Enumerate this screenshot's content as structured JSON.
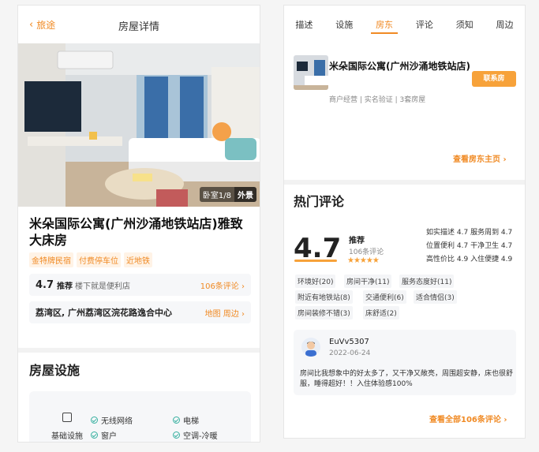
{
  "left": {
    "back_label": "旅途",
    "title": "房屋详情",
    "photo_room": "卧室1/8",
    "photo_view": "外景",
    "house_title": "米朵国际公寓(广州沙涌地铁站店)雅致大床房",
    "tags": [
      "金特牌民宿",
      "付费停车位",
      "近地铁"
    ],
    "rating": {
      "score": "4.7",
      "label": "推荐",
      "note": "楼下就是便利店",
      "link": "106条评论"
    },
    "address": {
      "text": "荔湾区, 广州荔湾区浣花路逸合中心",
      "link": "地图 周边"
    },
    "facilities_title": "房屋设施",
    "facilities": {
      "category": "基础设施",
      "items": [
        "无线网络",
        "电梯",
        "窗户",
        "空调-冷暖"
      ]
    }
  },
  "right": {
    "tabs": [
      "描述",
      "设施",
      "房东",
      "评论",
      "须知",
      "周边"
    ],
    "active_tab": "房东",
    "host": {
      "name": "米朵国际公寓(广州沙涌地铁站店)",
      "meta": "商户经营 | 实名验证 | 3套房屋",
      "contact_button": "联系房",
      "host_link": "查看房东主页"
    },
    "reviews": {
      "title": "热门评论",
      "score": "4.7",
      "recommend": "推荐",
      "count": "106条评论",
      "stars": "★★★★★",
      "subscores": [
        [
          "如实描述 4.7",
          "服务周到 4.7"
        ],
        [
          "位置便利 4.7",
          "干净卫生 4.7"
        ],
        [
          "高性价比 4.9",
          "入住便捷 4.9"
        ]
      ],
      "tags": [
        "环境好(20)",
        "房间干净(11)",
        "服务态度好(11)",
        "附近有地铁站(8)",
        "交通便利(6)",
        "适合情侣(3)",
        "房间装修不错(3)",
        "床舒适(2)"
      ],
      "item": {
        "user": "EuVv5307",
        "date": "2022-06-24",
        "text": "房间比我想象中的好太多了，又干净又敞亮，周围超安静，床也很舒服，睡得超好！！入住体验感100%"
      },
      "all_link": "查看全部106条评论"
    }
  }
}
